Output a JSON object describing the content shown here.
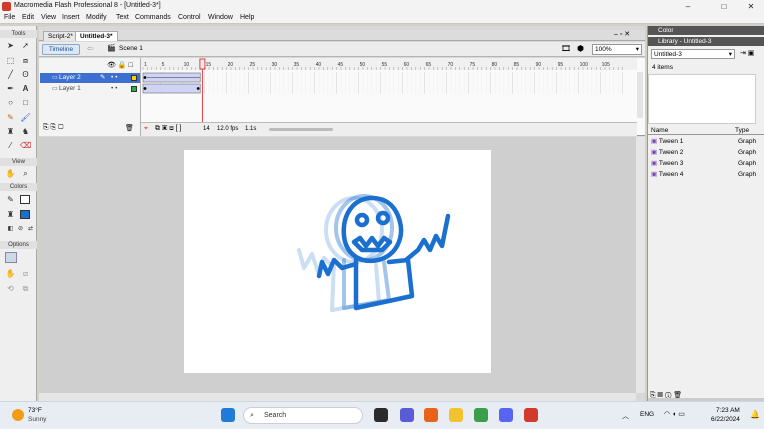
{
  "window": {
    "title": "Macromedia Flash Professional 8 - [Untitled-3*]",
    "controls": [
      "–",
      "□",
      "✕"
    ]
  },
  "menu": [
    "File",
    "Edit",
    "View",
    "Insert",
    "Modify",
    "Text",
    "Commands",
    "Control",
    "Window",
    "Help"
  ],
  "tools": {
    "section_tools": "Tools",
    "section_view": "View",
    "section_colors": "Colors",
    "section_options": "Options"
  },
  "doc_tabs": [
    "Script-2*",
    "Untitled-3*"
  ],
  "edit_bar": {
    "timeline_label": "Timeline",
    "scene_label": "Scene 1",
    "zoom": "100%"
  },
  "timeline": {
    "layers": [
      {
        "name": "Layer 2",
        "selected": true
      },
      {
        "name": "Layer 1",
        "selected": false
      }
    ],
    "frame_numbers": [
      "1",
      "5",
      "10",
      "15",
      "20",
      "25",
      "30",
      "35",
      "40",
      "45",
      "50",
      "55",
      "60",
      "65",
      "70",
      "75",
      "80",
      "85",
      "90",
      "95",
      "100",
      "105"
    ],
    "current_frame": "14",
    "fps": "12.0 fps",
    "elapsed": "1.1s"
  },
  "right_panel": {
    "color_title": "Color",
    "library_title": "Library - Untitled-3",
    "library_doc": "Untitled-3",
    "item_count": "4 items",
    "col_name": "Name",
    "col_type": "Type",
    "items": [
      {
        "name": "Tween 1",
        "type": "Graph"
      },
      {
        "name": "Tween 2",
        "type": "Graph"
      },
      {
        "name": "Tween 3",
        "type": "Graph"
      },
      {
        "name": "Tween 4",
        "type": "Graph"
      }
    ]
  },
  "taskbar": {
    "weather_temp": "73°F",
    "weather_desc": "Sunny",
    "search_placeholder": "Search",
    "lang": "ENG",
    "time": "7:23 AM",
    "date": "6/22/2024"
  },
  "colors": {
    "accent": "#3d6fd1",
    "drawing_blue": "#1a6fcf",
    "playhead": "#e33b3b"
  }
}
